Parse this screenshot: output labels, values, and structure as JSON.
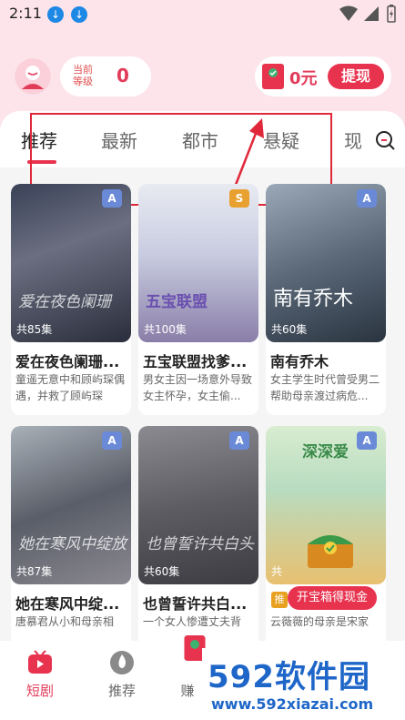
{
  "status_bar": {
    "time": "2:11"
  },
  "header": {
    "level_label": "当前等级",
    "level_value": "0",
    "reward_amount": "0元",
    "withdraw_label": "提现"
  },
  "tabs": [
    "推荐",
    "最新",
    "都市",
    "悬疑",
    "现"
  ],
  "cards": [
    {
      "episodes": "共85集",
      "badge": "A",
      "title": "爱在夜色阑珊...",
      "desc": "童遥无意中和顾屿琛偶遇，并救了顾屿琛",
      "poster_text": "爱在夜色阑珊"
    },
    {
      "episodes": "共100集",
      "badge": "S",
      "title": "五宝联盟找爹...",
      "desc": "男女主因一场意外导致女主怀孕，女主偷...",
      "poster_text": "五宝联盟"
    },
    {
      "episodes": "共60集",
      "badge": "A",
      "title": "南有乔木",
      "desc": "女主学生时代曾受男二帮助母亲渡过病危...",
      "poster_text": "南有乔木"
    },
    {
      "episodes": "共87集",
      "badge": "A",
      "title": "她在寒风中绽...",
      "desc": "唐慕君从小和母亲相",
      "poster_text": "她在寒风中绽放"
    },
    {
      "episodes": "共60集",
      "badge": "A",
      "title": "也曾誓许共白...",
      "desc": "一个女人惨遭丈夫背",
      "poster_text": "也曾誓许共白头"
    },
    {
      "episodes": "共",
      "badge": "A",
      "title": "",
      "desc": "云薇薇的母亲是宋家",
      "poster_text": "深深爱"
    }
  ],
  "chest_promo": {
    "tag": "推",
    "label": "开宝箱得现金"
  },
  "bottom_nav": [
    "短剧",
    "推荐",
    "赚"
  ],
  "watermark": {
    "brand": "592软件园",
    "url": "www.592xiazai.com"
  }
}
